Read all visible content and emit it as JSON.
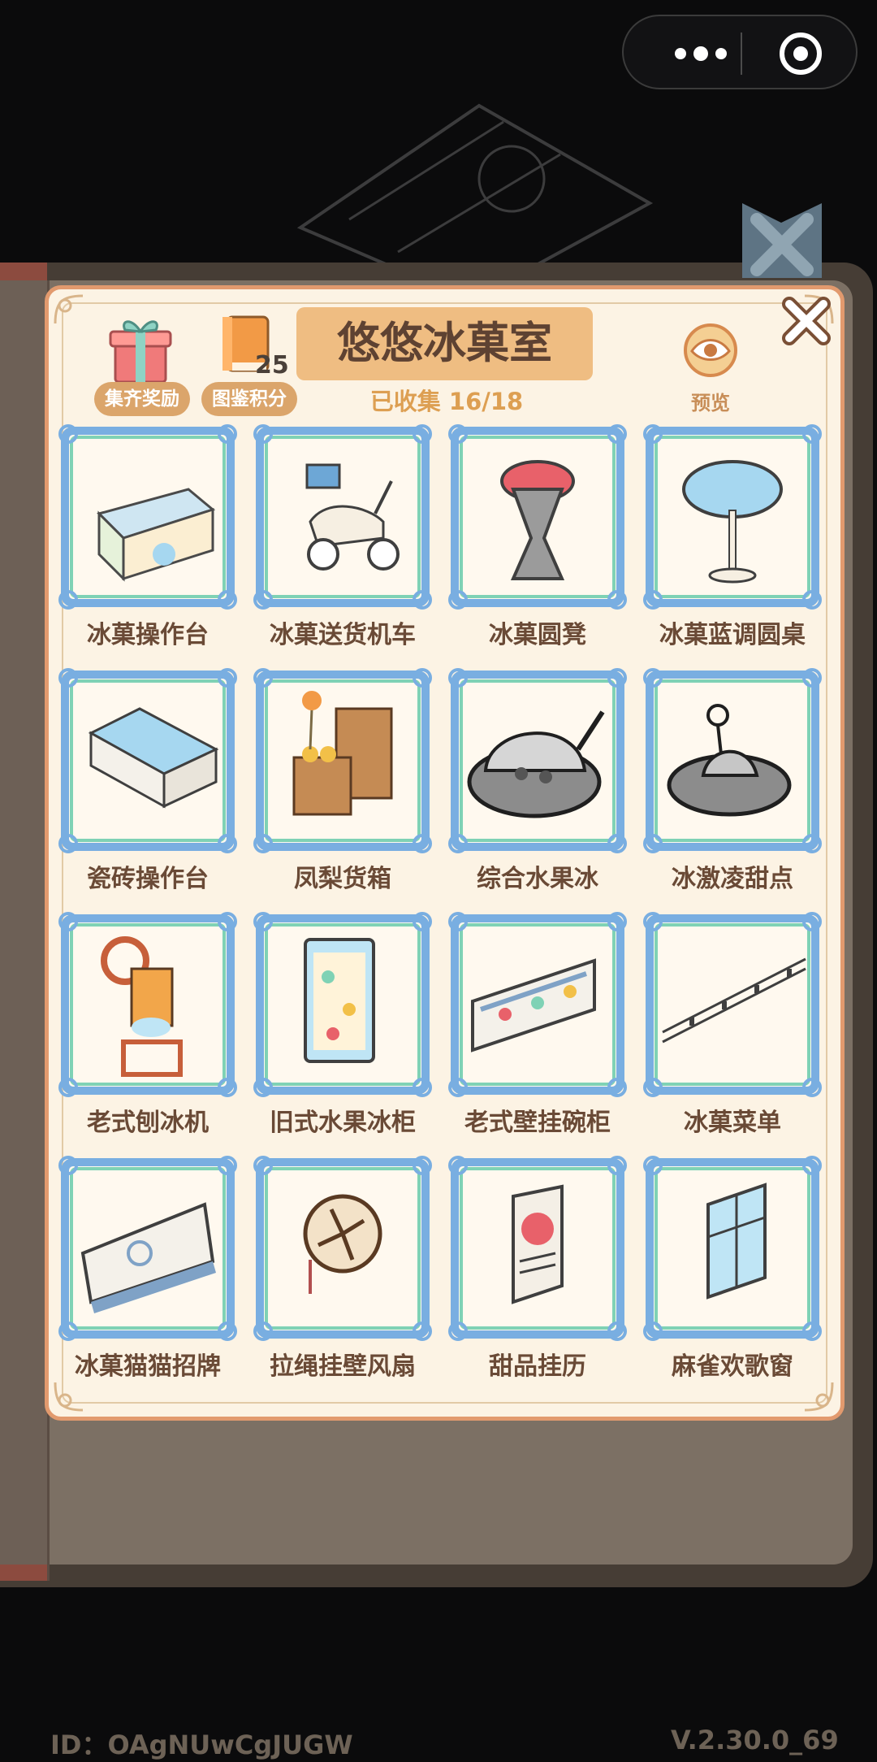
{
  "window": {
    "capsule": {
      "more_icon": "more-dots-icon",
      "close_icon": "target-close-icon"
    }
  },
  "panel": {
    "title": "悠悠冰菓室",
    "collected": "已收集 16/18",
    "reward_label": "集齐奖励",
    "score_label": "图鉴积分",
    "score_value": "25",
    "preview_label": "预览",
    "colors": {
      "panel_bg": "#fcf3e4",
      "border": "#e29a6e",
      "title_bg": "#efbd82",
      "accent_text": "#dd9f52",
      "frame_blue": "#79aee1",
      "frame_green": "#7fd2b5"
    }
  },
  "items": [
    {
      "name": "冰菓操作台",
      "collected": true
    },
    {
      "name": "冰菓送货机车",
      "collected": true
    },
    {
      "name": "冰菓圆凳",
      "collected": true
    },
    {
      "name": "冰菓蓝调圆桌",
      "collected": true
    },
    {
      "name": "瓷砖操作台",
      "collected": true
    },
    {
      "name": "凤梨货箱",
      "collected": true
    },
    {
      "name": "综合水果冰",
      "collected": false
    },
    {
      "name": "冰激凌甜点",
      "collected": false
    },
    {
      "name": "老式刨冰机",
      "collected": true
    },
    {
      "name": "旧式水果冰柜",
      "collected": true
    },
    {
      "name": "老式壁挂碗柜",
      "collected": true
    },
    {
      "name": "冰菓菜单",
      "collected": true
    },
    {
      "name": "冰菓猫猫招牌",
      "collected": true
    },
    {
      "name": "拉绳挂壁风扇",
      "collected": true
    },
    {
      "name": "甜品挂历",
      "collected": true
    },
    {
      "name": "麻雀欢歌窗",
      "collected": true
    }
  ],
  "footer": {
    "id": "ID：OAgNUwCgJUGW",
    "version": "V.2.30.0_69"
  }
}
